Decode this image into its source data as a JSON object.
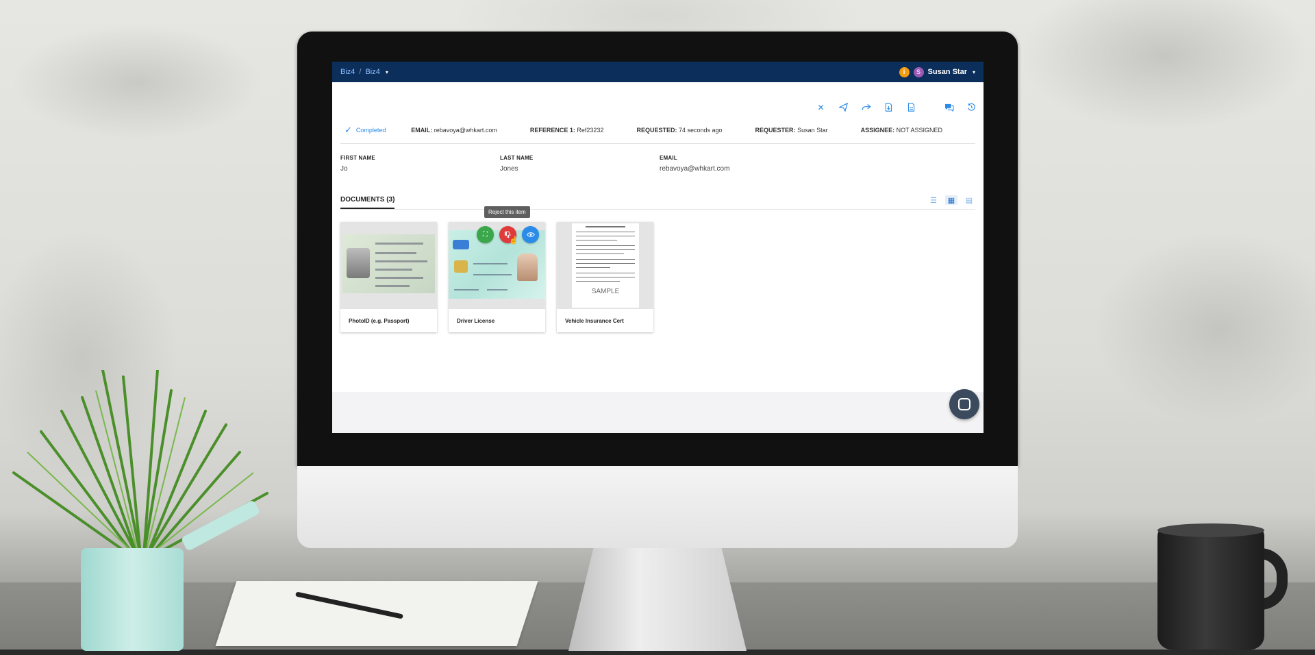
{
  "breadcrumb": {
    "org": "Biz4",
    "workspace": "Biz4"
  },
  "user": {
    "initial": "S",
    "name": "Susan Star"
  },
  "toolbar_icons": [
    "close-icon",
    "send-icon",
    "forward-icon",
    "download-doc-icon",
    "pdf-doc-icon",
    "chat-icon",
    "history-icon"
  ],
  "summary": {
    "status": "Completed",
    "email_label": "EMAIL:",
    "email": "rebavoya@whkart.com",
    "ref_label": "REFERENCE 1:",
    "ref": "Ref23232",
    "requested_label": "REQUESTED:",
    "requested": "74 seconds ago",
    "requester_label": "REQUESTER:",
    "requester": "Susan Star",
    "assignee_label": "ASSIGNEE:",
    "assignee": "NOT ASSIGNED"
  },
  "fields": [
    {
      "label": "FIRST NAME",
      "value": "Jo"
    },
    {
      "label": "LAST NAME",
      "value": "Jones"
    },
    {
      "label": "EMAIL",
      "value": "rebavoya@whkart.com"
    }
  ],
  "documents": {
    "tab_label": "DOCUMENTS (3)",
    "items": [
      {
        "label": "PhotoID (e.g. Passport)"
      },
      {
        "label": "Driver License"
      },
      {
        "label": "Vehicle Insurance Cert",
        "watermark": "SAMPLE"
      }
    ],
    "tooltip": "Reject this item"
  },
  "colors": {
    "topbar": "#0b2e5b",
    "accent": "#2a8be8",
    "expand_btn": "#3aa84a",
    "reject_btn": "#e03a3a",
    "view_btn": "#2a8be8"
  }
}
